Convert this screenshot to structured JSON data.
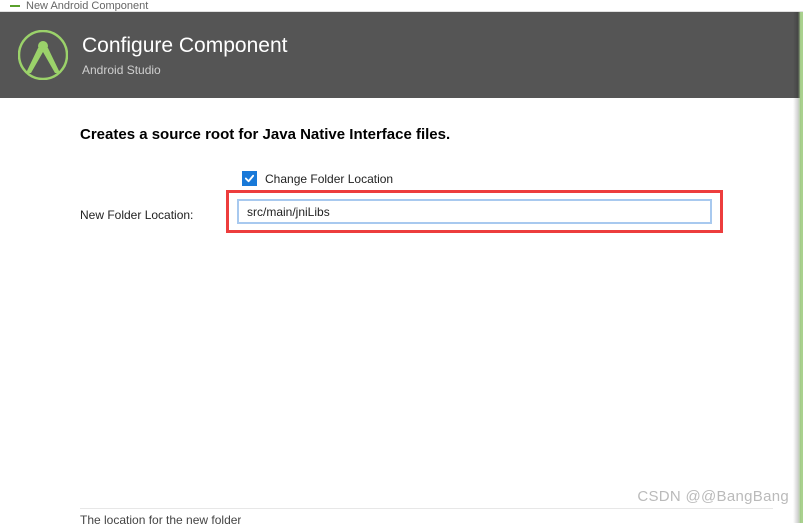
{
  "window": {
    "title": "New Android Component"
  },
  "header": {
    "title": "Configure Component",
    "subtitle": "Android Studio"
  },
  "content": {
    "description": "Creates a source root for Java Native Interface files.",
    "change_folder_label": "Change Folder Location",
    "change_folder_checked": true,
    "folder_label": "New Folder Location:",
    "folder_value": "src/main/jniLibs",
    "bottom_hint": "The location for the new folder"
  },
  "watermark": "CSDN @@BangBang"
}
